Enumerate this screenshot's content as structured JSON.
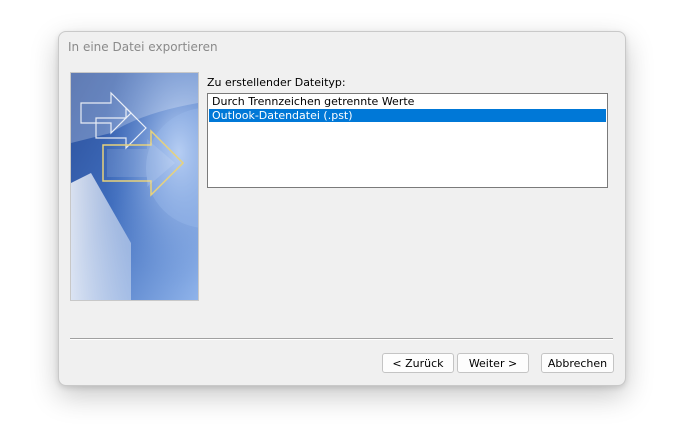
{
  "window": {
    "title": "In eine Datei exportieren"
  },
  "main": {
    "list_label": "Zu erstellender Dateityp:",
    "file_types": [
      "Durch Trennzeichen getrennte Werte",
      "Outlook-Datendatei (.pst)"
    ],
    "selected_index": 1
  },
  "buttons": {
    "back": "< Zurück",
    "next": "Weiter >",
    "cancel": "Abbrechen"
  },
  "colors": {
    "selection": "#0078d7",
    "dialog_background": "#f0f0f0"
  },
  "icons": {
    "wizard_image": "export-arrows-graphic"
  }
}
